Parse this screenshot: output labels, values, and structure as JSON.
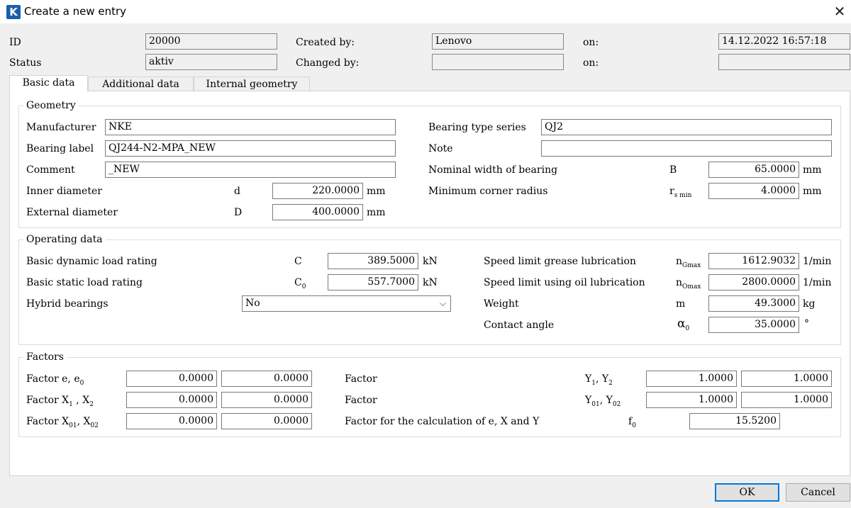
{
  "window": {
    "title": "Create a new entry",
    "app_icon_letter": "K",
    "close_glyph": "✕"
  },
  "header": {
    "id_label": "ID",
    "id_value": "20000",
    "status_label": "Status",
    "status_value": "aktiv",
    "created_by_label": "Created by:",
    "created_by_value": "Lenovo",
    "changed_by_label": "Changed by:",
    "changed_by_value": "",
    "created_on_label": "on:",
    "created_on_value": "14.12.2022 16:57:18",
    "changed_on_label": "on:",
    "changed_on_value": ""
  },
  "tabs": [
    {
      "label": "Basic data",
      "active": true
    },
    {
      "label": "Additional data",
      "active": false
    },
    {
      "label": "Internal geometry",
      "active": false
    }
  ],
  "geometry": {
    "title": "Geometry",
    "manufacturer_label": "Manufacturer",
    "manufacturer_value": "NKE",
    "bearing_label_label": "Bearing label",
    "bearing_label_value": "QJ244-N2-MPA_NEW",
    "comment_label": "Comment",
    "comment_value": "_NEW",
    "inner_diameter_label": "Inner diameter",
    "inner_diameter_symbol": "d",
    "inner_diameter_value": "220.0000",
    "inner_diameter_unit": "mm",
    "external_diameter_label": "External diameter",
    "external_diameter_symbol": "D",
    "external_diameter_value": "400.0000",
    "external_diameter_unit": "mm",
    "type_series_label": "Bearing type series",
    "type_series_value": "QJ2",
    "note_label": "Note",
    "note_value": "",
    "width_label": "Nominal width of bearing",
    "width_symbol": "B",
    "width_value": "65.0000",
    "width_unit": "mm",
    "radius_label": "Minimum corner radius",
    "radius_symbol": "r",
    "radius_symbol_sub": "s min",
    "radius_value": "4.0000",
    "radius_unit": "mm"
  },
  "operating": {
    "title": "Operating data",
    "dynamic_label": "Basic dynamic load rating",
    "dynamic_symbol": "C",
    "dynamic_value": "389.5000",
    "dynamic_unit": "kN",
    "static_label": "Basic static load rating",
    "static_symbol": "C",
    "static_symbol_sub": "0",
    "static_value": "557.7000",
    "static_unit": "kN",
    "hybrid_label": "Hybrid bearings",
    "hybrid_value": "No",
    "grease_label": "Speed limit grease lubrication",
    "grease_symbol": "n",
    "grease_symbol_sub": "Gmax",
    "grease_value": "1612.9032",
    "grease_unit": "1/min",
    "oil_label": "Speed limit using oil lubrication",
    "oil_symbol": "n",
    "oil_symbol_sub": "Omax",
    "oil_value": "2800.0000",
    "oil_unit": "1/min",
    "weight_label": "Weight",
    "weight_symbol": "m",
    "weight_value": "49.3000",
    "weight_unit": "kg",
    "contact_label": "Contact angle",
    "contact_symbol": "α",
    "contact_symbol_sub": "0",
    "contact_value": "35.0000",
    "contact_unit": "°"
  },
  "factors": {
    "title": "Factors",
    "e_label": "Factor e, e",
    "e_label_sub": "0",
    "e_value1": "0.0000",
    "e_value2": "0.0000",
    "x_label": "Factor X",
    "x_label_sub1": "1",
    "x_label_mid": " , X",
    "x_label_sub2": "2",
    "x_value1": "0.0000",
    "x_value2": "0.0000",
    "x0_label": "Factor X",
    "x0_label_sub1": "01",
    "x0_label_mid": ", X",
    "x0_label_sub2": "02",
    "x0_value1": "0.0000",
    "x0_value2": "0.0000",
    "y_label": "Factor",
    "y_symbol": "Y",
    "y_symbol_sub1": "1",
    "y_symbol_mid": ", Y",
    "y_symbol_sub2": "2",
    "y_value1": "1.0000",
    "y_value2": "1.0000",
    "y0_label": "Factor",
    "y0_symbol": "Y",
    "y0_symbol_sub1": "01",
    "y0_symbol_mid": ", Y",
    "y0_symbol_sub2": "02",
    "y0_value1": "1.0000",
    "y0_value2": "1.0000",
    "f0_label": "Factor for the calculation of e, X and Y",
    "f0_symbol": "f",
    "f0_symbol_sub": "0",
    "f0_value": "15.5200"
  },
  "buttons": {
    "ok": "OK",
    "cancel": "Cancel"
  }
}
